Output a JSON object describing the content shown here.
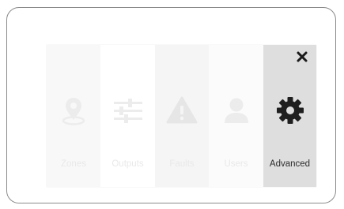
{
  "menu": {
    "tiles": [
      {
        "label": "Zones",
        "icon": "map-pin-icon",
        "active": false
      },
      {
        "label": "Outputs",
        "icon": "sliders-icon",
        "active": false
      },
      {
        "label": "Faults",
        "icon": "warning-icon",
        "active": false
      },
      {
        "label": "Users",
        "icon": "user-icon",
        "active": false
      },
      {
        "label": "Advanced",
        "icon": "gear-icon",
        "active": true
      }
    ],
    "close_icon": "close-icon"
  },
  "colors": {
    "inactive_icon": "#ececec",
    "inactive_label": "#e9e9e9",
    "active_icon": "#1f1f1f",
    "active_label": "#2b2b2b",
    "active_background": "#dedede",
    "device_border": "#8a8a8a"
  }
}
